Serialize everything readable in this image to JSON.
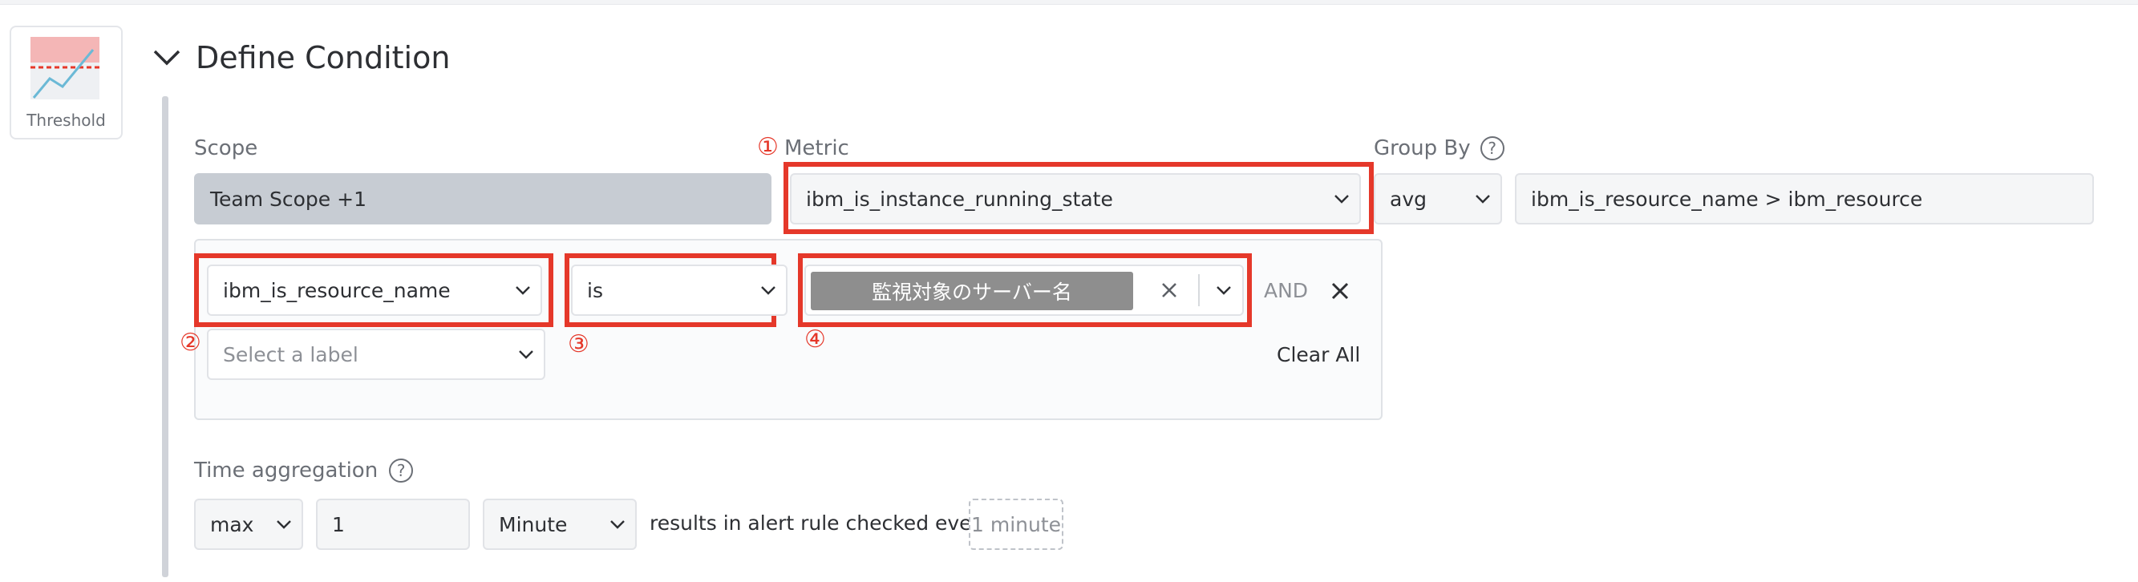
{
  "threshold_card": {
    "label": "Threshold"
  },
  "section": {
    "title": "Define Condition"
  },
  "scope": {
    "label": "Scope",
    "value": "Team Scope +1"
  },
  "metric": {
    "marker": "①",
    "label": "Metric",
    "value": "ibm_is_instance_running_state"
  },
  "group_by": {
    "label": "Group By",
    "help": "?",
    "aggregation": "avg",
    "value": "ibm_is_resource_name > ibm_resource"
  },
  "condition": {
    "label_marker": "②",
    "label_value": "ibm_is_resource_name",
    "operator_marker": "③",
    "operator_value": "is",
    "value_marker": "④",
    "value_tag": "監視対象のサーバー名",
    "and_text": "AND",
    "select_placeholder": "Select a label",
    "clear_all": "Clear All"
  },
  "time_aggregation": {
    "label": "Time aggregation",
    "help": "?",
    "function": "max",
    "count": "1",
    "unit": "Minute",
    "suffix_text": "results in alert rule checked every",
    "interval": "1 minute"
  },
  "colors": {
    "highlight": "#e5382a",
    "scope_bg": "#c7ccd3",
    "tag_bg": "#8e8e8e"
  }
}
